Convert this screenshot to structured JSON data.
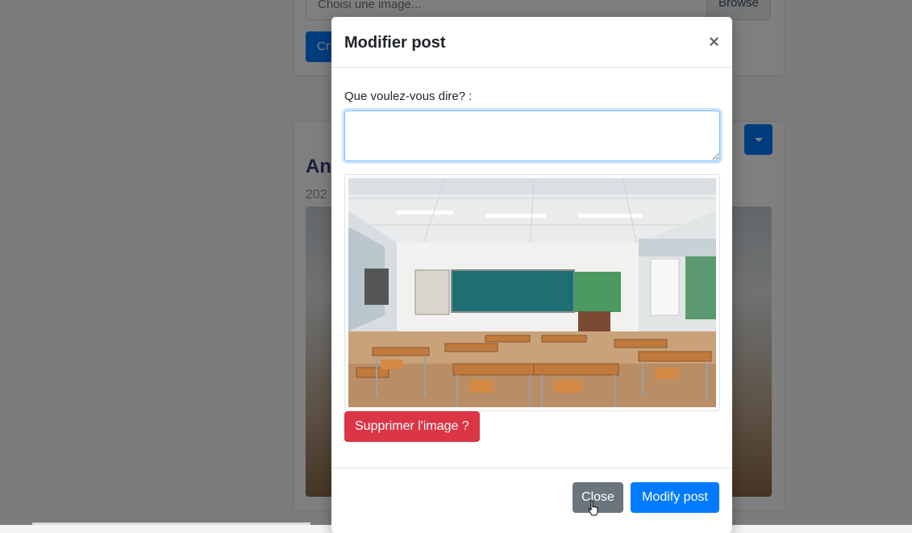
{
  "background": {
    "file_input_placeholder": "Choisi une image...",
    "browse_label": "Browse",
    "create_button_label": "Cr",
    "post_title": "An",
    "post_date": "202"
  },
  "modal": {
    "title": "Modifier post",
    "close_symbol": "×",
    "field_label": "Que voulez-vous dire? :",
    "textarea_value": "",
    "delete_image_label": "Supprimer l'image ?",
    "close_button_label": "Close",
    "modify_button_label": "Modify post"
  },
  "colors": {
    "primary": "#007bff",
    "danger": "#dc3545",
    "secondary": "#6c757d"
  },
  "icons": [
    "close-icon",
    "caret-down-icon",
    "mouse-cursor-icon"
  ]
}
